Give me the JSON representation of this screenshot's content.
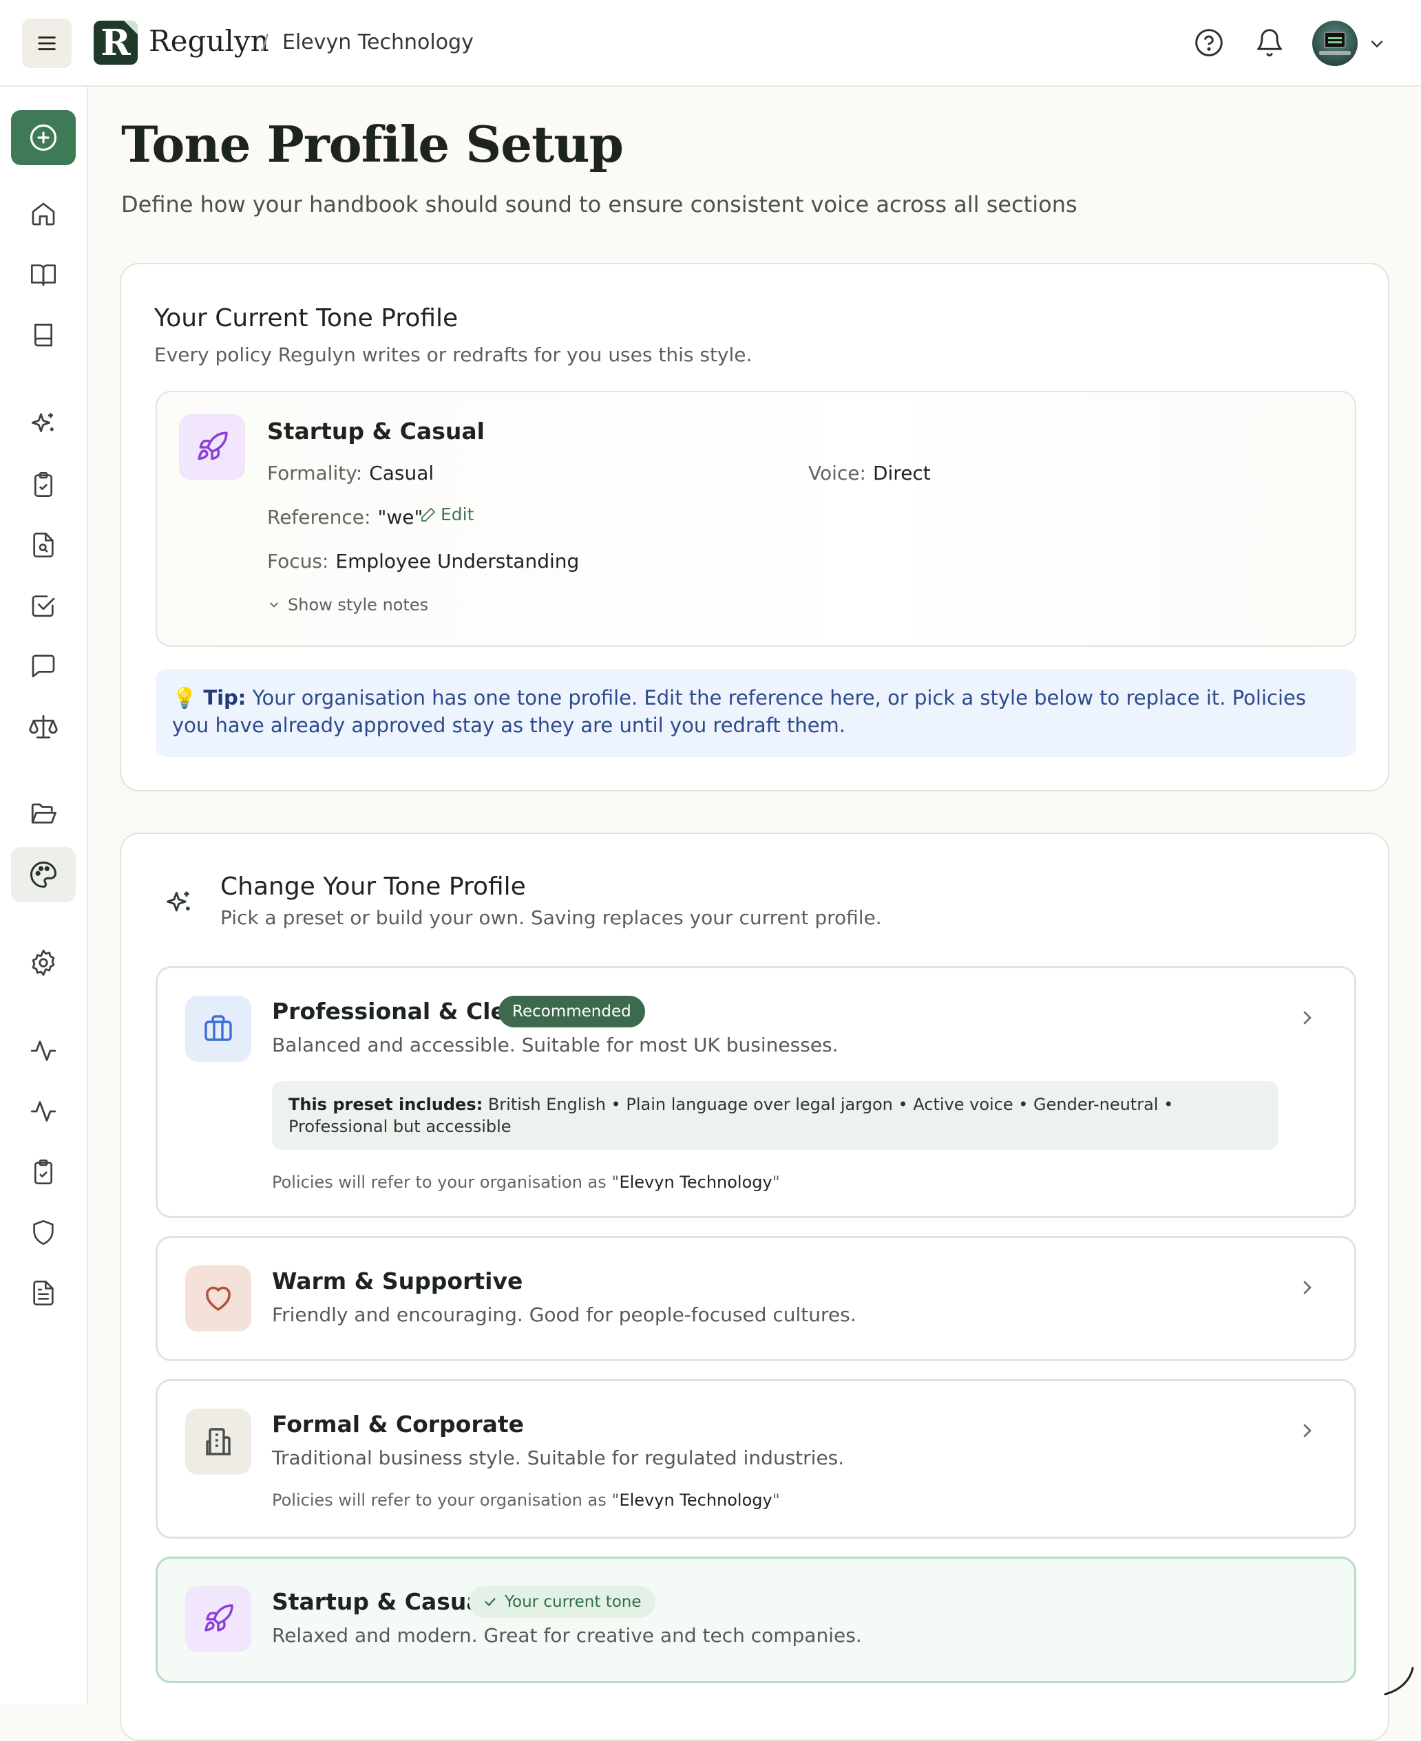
{
  "app": {
    "name": "Regulyn",
    "logo_letter": "R",
    "breadcrumb_sep": "/",
    "org": "Elevyn Technology"
  },
  "page": {
    "title": "Tone Profile Setup",
    "subtitle": "Define how your handbook should sound to ensure consistent voice across all sections"
  },
  "current": {
    "title": "Your Current Tone Profile",
    "subtitle": "Every policy Regulyn writes or redrafts for you uses this style.",
    "profile_name": "Startup & Casual",
    "formality_label": "Formality:",
    "formality_value": "Casual",
    "voice_label": "Voice:",
    "voice_value": "Direct",
    "reference_label": "Reference:",
    "reference_value": "\"we\"",
    "edit_label": "Edit",
    "focus_label": "Focus:",
    "focus_value": "Employee Understanding",
    "style_notes_label": "Show style notes",
    "tip_label": "Tip:",
    "tip_text": "Your organisation has one tone profile. Edit the reference here, or pick a style below to replace it. Policies you have already approved stay as they are until you redraft them."
  },
  "change": {
    "title": "Change Your Tone Profile",
    "subtitle": "Pick a preset or build your own. Saving replaces your current profile.",
    "ref_prefix": "Policies will refer to your organisation as \"",
    "ref_org": "Elevyn Technology",
    "ref_suffix": "\"",
    "presets": [
      {
        "title": "Professional & Clear",
        "badge": "Recommended",
        "desc": "Balanced and accessible. Suitable for most UK businesses.",
        "includes_label": "This preset includes:",
        "includes_text": "British English • Plain language over legal jargon • Active voice • Gender-neutral • Professional but accessible"
      },
      {
        "title": "Warm & Supportive",
        "desc": "Friendly and encouraging. Good for people-focused cultures."
      },
      {
        "title": "Formal & Corporate",
        "desc": "Traditional business style. Suitable for regulated industries."
      },
      {
        "title": "Startup & Casual",
        "badge": "Your current tone",
        "desc": "Relaxed and modern. Great for creative and tech companies."
      }
    ]
  },
  "colors": {
    "brand": "#1f3a2b",
    "accent": "#3f7a56",
    "tip_bg": "#eef4fd",
    "tip_text": "#2c4a8d",
    "current_border": "#b7dcc3"
  },
  "icons": [
    "menu-icon",
    "help-icon",
    "bell-icon",
    "chevron-down-icon",
    "plus-circle-icon",
    "home-icon",
    "book-open-icon",
    "book-icon",
    "sparkles-icon",
    "clipboard-check-icon",
    "file-search-icon",
    "check-square-icon",
    "message-icon",
    "scales-icon",
    "folder-open-icon",
    "palette-icon",
    "gear-icon",
    "activity-icon",
    "shield-icon",
    "file-text-icon",
    "rocket-icon",
    "briefcase-icon",
    "heart-icon",
    "building-icon",
    "chevron-right-icon",
    "pencil-icon",
    "check-icon"
  ]
}
